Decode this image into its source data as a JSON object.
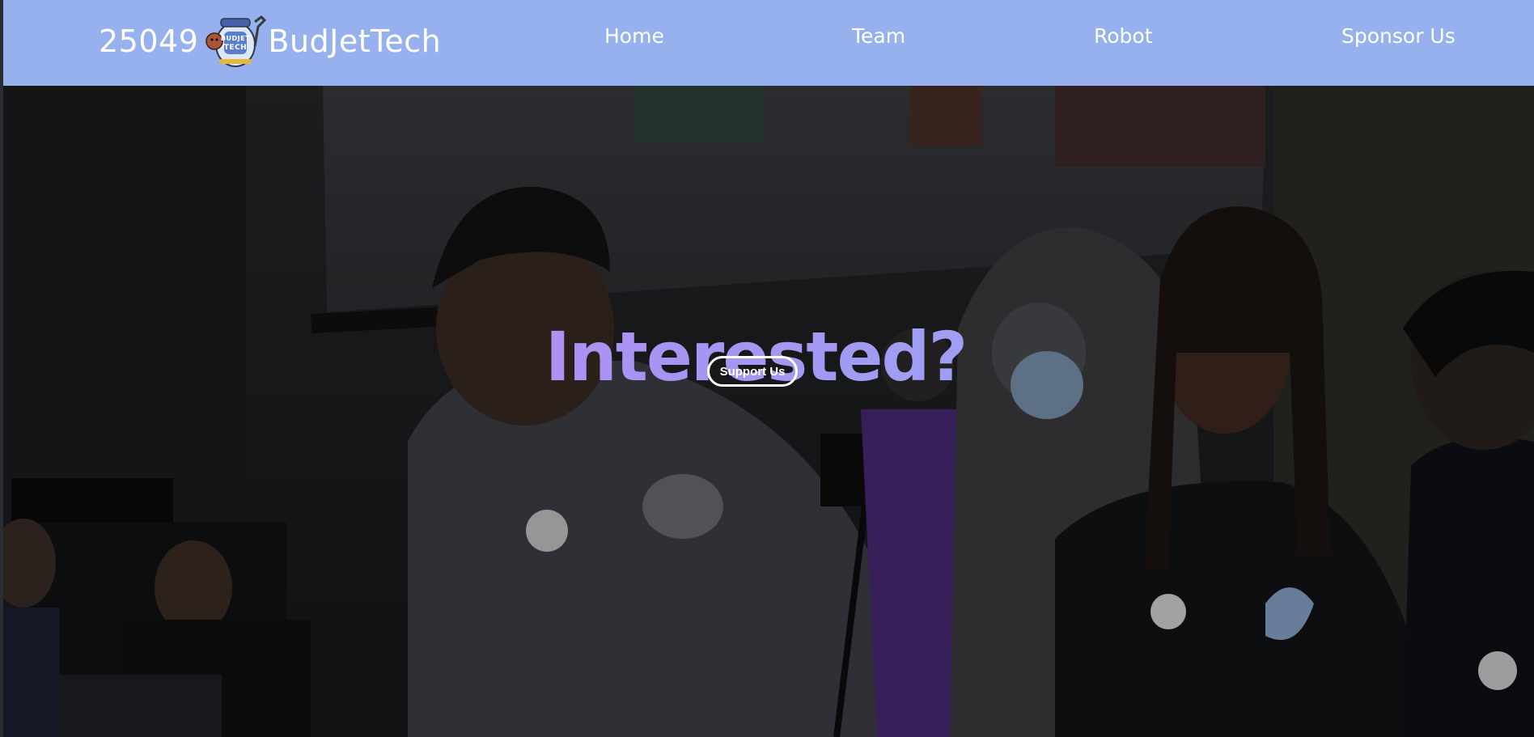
{
  "navbar": {
    "brand_number": "25049",
    "brand_name": "BudJetTech",
    "logo_icon": "budjet-tech-logo",
    "links": [
      {
        "label": "Home"
      },
      {
        "label": "Team"
      },
      {
        "label": "Robot"
      },
      {
        "label": "Sponsor Us"
      }
    ],
    "background_color": "#97b1ee"
  },
  "hero": {
    "title": "Interested?",
    "button_label": "Support Us",
    "title_gradient": [
      "#c88bf0",
      "#a794f2",
      "#8cb6f5"
    ]
  }
}
